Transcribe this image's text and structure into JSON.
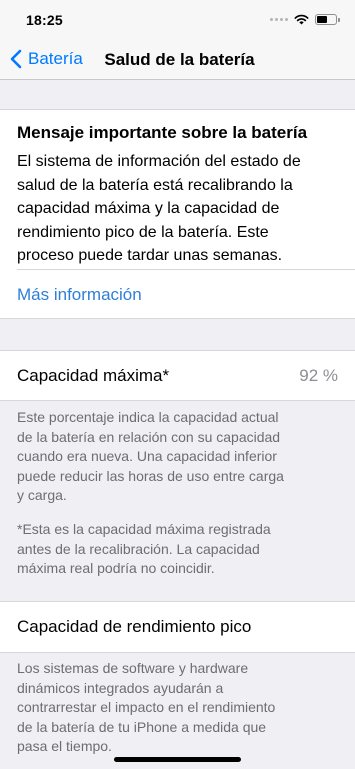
{
  "status_bar": {
    "time": "18:25",
    "icons": [
      "signal-dots",
      "wifi-icon",
      "battery-icon"
    ]
  },
  "nav": {
    "back_label": "Batería",
    "title": "Salud de la batería"
  },
  "message": {
    "title": "Mensaje importante sobre la batería",
    "lines": [
      "El sistema de información del estado de",
      "salud de la batería está recalibrando la",
      "capacidad máxima y la capacidad de",
      "rendimiento pico de la batería. Este",
      "proceso puede tardar unas semanas."
    ],
    "link_label": "Más información"
  },
  "capacity": {
    "label": "Capacidad máxima*",
    "value": "92 %",
    "footer_lines": [
      "Este porcentaje indica la capacidad actual",
      "de la batería en relación con su capacidad",
      "cuando era nueva. Una capacidad inferior",
      "puede reducir las horas de uso entre carga",
      "y carga."
    ],
    "note_lines": [
      "*Esta es la capacidad máxima registrada",
      "antes de la recalibración. La capacidad",
      "máxima real podría no coincidir."
    ]
  },
  "peak": {
    "label": "Capacidad de rendimiento pico",
    "footer_lines": [
      "Los sistemas de software y hardware",
      "dinámicos integrados ayudarán a",
      "contrarrestar el impacto en el rendimiento",
      "de la batería de tu iPhone a medida que",
      "pasa el tiempo."
    ]
  },
  "colors": {
    "accent": "#007aff",
    "link": "#2f7fd8",
    "background": "#efeff4",
    "secondary_text": "#6d6d72"
  }
}
